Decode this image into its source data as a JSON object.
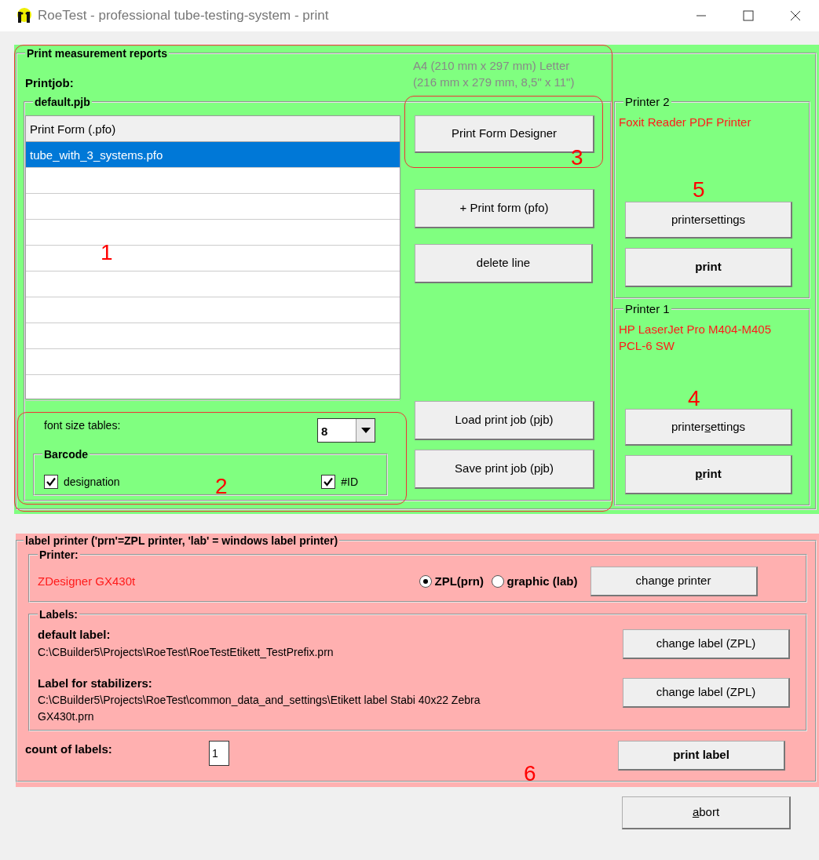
{
  "window": {
    "title": "RoeTest - professional tube-testing-system - print"
  },
  "reports": {
    "title": "Print measurement reports",
    "printjob_label": "Printjob:",
    "paper_note": [
      "A4 (210 mm x 297 mm) Letter",
      "(216 mm x 279 mm,  8,5\" x 11\")"
    ],
    "job": {
      "title": "default.pjb",
      "table": {
        "columns": [
          "Print Form (.pfo)"
        ],
        "rows": [
          {
            "cells": [
              "tube_with_3_systems.pfo"
            ],
            "selected": true
          }
        ]
      },
      "font_size": {
        "label": "font size tables:",
        "value": "8"
      },
      "barcode": {
        "title": "Barcode",
        "options": [
          {
            "label": "designation",
            "checked": true
          },
          {
            "label": "#ID",
            "checked": true
          }
        ]
      },
      "top_buttons": [
        {
          "label": "Print Form Designer"
        },
        {
          "label": "+ Print form (pfo)"
        },
        {
          "label": "delete line"
        }
      ],
      "bottom_buttons": [
        {
          "label": "Load print job (pjb)"
        },
        {
          "label": "Save print job (pjb)"
        }
      ]
    },
    "printers": [
      {
        "title": "Printer 2",
        "name": "Foxit Reader PDF Printer",
        "buttons": [
          {
            "label_parts": [
              {
                "text": "printersettings",
                "underlined": false
              }
            ]
          },
          {
            "label_parts": [
              {
                "text": "print",
                "underlined": false
              }
            ]
          }
        ]
      },
      {
        "title": "Printer 1",
        "name": "HP LaserJet Pro M404-M405 PCL-6 SW",
        "buttons": [
          {
            "label_parts": [
              {
                "text": "printer",
                "underlined": false
              },
              {
                "text": "s",
                "underlined": true
              },
              {
                "text": "ettings",
                "underlined": false
              }
            ]
          },
          {
            "label_parts": [
              {
                "text": "p",
                "underlined": true
              },
              {
                "text": "rint",
                "underlined": false
              }
            ]
          }
        ]
      }
    ]
  },
  "label_printer": {
    "title": "label printer ('prn'=ZPL printer, 'lab' = windows label printer)",
    "printer": {
      "title": "Printer:",
      "name": "ZDesigner GX430t",
      "modes": [
        {
          "label": "ZPL(prn)",
          "selected": true
        },
        {
          "label": "graphic (lab)",
          "selected": false
        }
      ],
      "button": "change printer"
    },
    "labels": {
      "title": "Labels:",
      "items": [
        {
          "title": "default label:",
          "path": "C:\\CBuilder5\\Projects\\RoeTest\\RoeTestEtikett_TestPrefix.prn",
          "button": "change label (ZPL)"
        },
        {
          "title": "Label for stabilizers:",
          "path": "C:\\CBuilder5\\Projects\\RoeTest\\common_data_and_settings\\Etikett label Stabi 40x22 Zebra GX430t.prn",
          "button": "change label (ZPL)"
        }
      ]
    },
    "count": {
      "label": "count of labels:",
      "value": "1"
    },
    "print_button": "print label"
  },
  "abort_button": {
    "label_parts": [
      {
        "text": "a",
        "underlined": true
      },
      {
        "text": "bort",
        "underlined": false
      }
    ]
  },
  "annotations": [
    {
      "number": "1"
    },
    {
      "number": "2"
    },
    {
      "number": "3"
    },
    {
      "number": "4"
    },
    {
      "number": "5"
    },
    {
      "number": "6"
    }
  ]
}
